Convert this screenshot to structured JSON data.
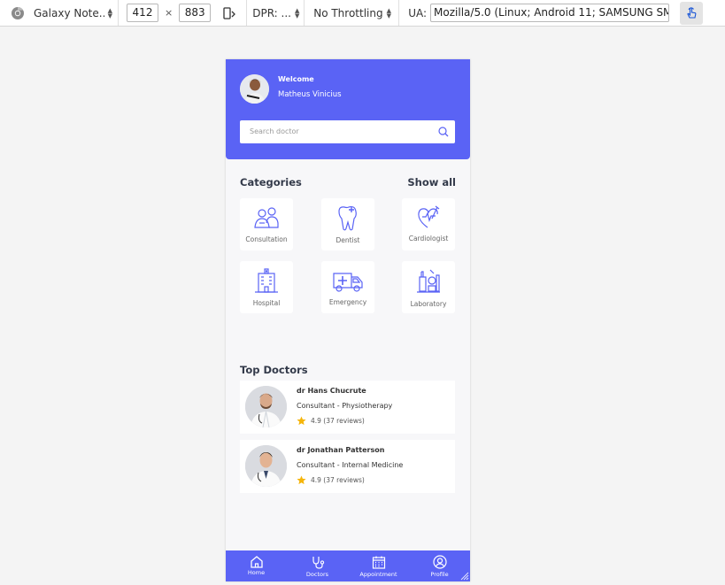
{
  "toolbar": {
    "device": "Galaxy Note...",
    "width": "412",
    "times": "×",
    "height": "883",
    "dpr": "DPR: ...",
    "throttle": "No Throttling",
    "ua_label": "UA:",
    "ua_value": "Mozilla/5.0 (Linux; Android 11; SAMSUNG SM-("
  },
  "app": {
    "header": {
      "welcome": "Welcome",
      "user_name": "Matheus Vinicius",
      "search_placeholder": "Search  doctor"
    },
    "categories": {
      "title": "Categories",
      "show_all": "Show all",
      "items": [
        {
          "label": "Consultation",
          "icon": "consultation-icon"
        },
        {
          "label": "Dentist",
          "icon": "tooth-icon"
        },
        {
          "label": "Cardiologist",
          "icon": "heart-icon"
        },
        {
          "label": "Hospital",
          "icon": "hospital-icon"
        },
        {
          "label": "Emergency",
          "icon": "ambulance-icon"
        },
        {
          "label": "Laboratory",
          "icon": "lab-icon"
        }
      ]
    },
    "top_doctors": {
      "title": "Top Doctors",
      "doctors": [
        {
          "name": "dr Hans Chucrute",
          "specialty": "Consultant - Physiotherapy",
          "rating": "4.9 (37 reviews)"
        },
        {
          "name": "dr Jonathan Patterson",
          "specialty": "Consultant - Internal Medicine",
          "rating": "4.9 (37 reviews)"
        }
      ]
    },
    "tabs": [
      {
        "label": "Home",
        "icon": "home-icon"
      },
      {
        "label": "Doctors",
        "icon": "stethoscope-icon"
      },
      {
        "label": "Appointment",
        "icon": "calendar-icon"
      },
      {
        "label": "Profile",
        "icon": "profile-icon"
      }
    ]
  },
  "colors": {
    "primary": "#5a63f5",
    "star": "#f5b50a",
    "icon_stroke": "#5a63f5"
  }
}
